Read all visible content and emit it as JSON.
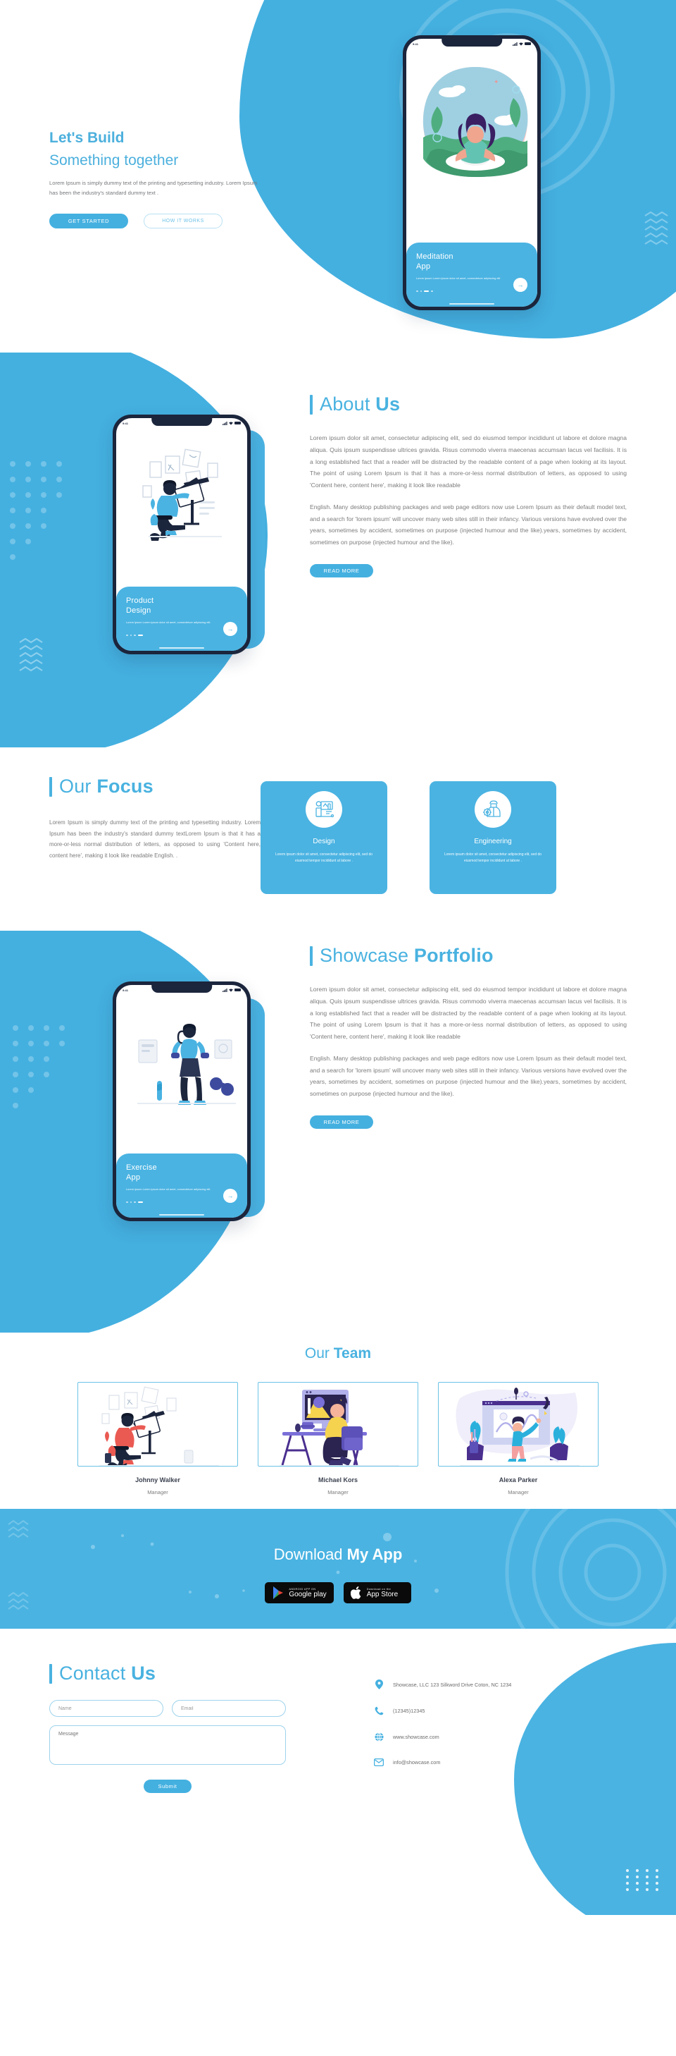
{
  "theme": {
    "accent": "#44b0e0",
    "accent_dark": "#1b253c",
    "text": "#7c7c7c"
  },
  "hero": {
    "title_line1": "Let's Build",
    "title_line2": "Something together",
    "paragraph": "Lorem Ipsum is simply dummy text of the printing and typesetting industry. Lorem Ipsum has been the industry's standard dummy text .",
    "primary_button": "GET STARTED",
    "secondary_button": "HOW IT WORKS",
    "phone": {
      "status_time": "9:41",
      "card_title_line1": "Meditation",
      "card_title_line2": "App",
      "card_text": "Lorem ipsum Lorem ipsum dolor sit amet, consectetuer adipiscing elit",
      "next_icon": "arrow-right-icon"
    }
  },
  "about": {
    "title_light": "About",
    "title_bold": "Us",
    "paragraph1": "Lorem ipsum dolor sit amet, consectetur adipiscing elit, sed do eiusmod tempor incididunt ut labore et dolore magna aliqua. Quis ipsum suspendisse ultrices gravida. Risus commodo viverra maecenas accumsan lacus vel facilisis. It is a long established fact that a reader will be distracted by the readable content of a page when looking at its layout. The point of using Lorem Ipsum is that it has a more-or-less normal distribution of letters, as opposed to using 'Content here, content here', making it look like readable",
    "paragraph2": "English. Many desktop publishing packages and web page editors now use Lorem Ipsum as their default model text, and a search for 'lorem ipsum' will uncover many web sites still in their infancy. Various versions have evolved over the years, sometimes by accident, sometimes on purpose (injected humour and the like).years, sometimes by accident, sometimes on purpose (injected humour and the like).",
    "read_more": "READ MORE",
    "phone": {
      "status_time": "9:41",
      "card_title_line1": "Product",
      "card_title_line2": "Design",
      "card_text": "Lorem ipsum Lorem ipsum dolor sit amet, consectetuer adipiscing elit.",
      "next_icon": "arrow-right-icon"
    }
  },
  "focus": {
    "title_light": "Our",
    "title_bold": "Focus",
    "paragraph": "Lorem Ipsum is simply dummy text of the printing and typesetting industry. Lorem Ipsum has been the industry's standard dummy textLorem Ipsum is that it has a more-or-less normal distribution of letters, as opposed to using 'Content here, content here', making it look like readable English. .",
    "cards": [
      {
        "icon": "design-desk-icon",
        "title": "Design",
        "text": "Lorem ipsum dolor sit amet, consectetur adipiscing elit, sed do eiusmod tempor incididunt ut labore ."
      },
      {
        "icon": "engineer-gear-icon",
        "title": "Engineering",
        "text": "Lorem ipsum dolor sit amet, consectetur adipiscing elit, sed do eiusmod tempor incididunt ut labore ."
      }
    ]
  },
  "showcase": {
    "title_light": "Showcase",
    "title_bold": "Portfolio",
    "paragraph1": "Lorem ipsum dolor sit amet, consectetur adipiscing elit, sed do eiusmod tempor incididunt ut labore et dolore magna aliqua. Quis ipsum suspendisse ultrices gravida. Risus commodo viverra maecenas accumsan lacus vel facilisis. It is a long established fact that a reader will be distracted by the readable content of a page when looking at its layout. The point of using Lorem Ipsum is that it has a more-or-less normal distribution of letters, as opposed to using 'Content here, content here', making it look like readable",
    "paragraph2": "English. Many desktop publishing packages and web page editors now use Lorem Ipsum as their default model text, and a search for 'lorem ipsum' will uncover many web sites still in their infancy. Various versions have evolved over the years, sometimes by accident, sometimes on purpose (injected humour and the like).years, sometimes by accident, sometimes on purpose (injected humour and the like).",
    "read_more": "READ MORE",
    "phone": {
      "status_time": "9:41",
      "card_title_line1": "Exercise",
      "card_title_line2": "App",
      "card_text": "Lorem ipsum Lorem ipsum dolor sit amet, consectetuer adipiscing elit.",
      "next_icon": "arrow-right-icon"
    }
  },
  "team": {
    "title_light": "Our",
    "title_bold": "Team",
    "members": [
      {
        "name": "Johnny Walker",
        "role": "Manager",
        "illustration": "illustrator-at-easel-icon"
      },
      {
        "name": "Michael Kors",
        "role": "Manager",
        "illustration": "designer-at-desktop-icon"
      },
      {
        "name": "Alexa Parker",
        "role": "Manager",
        "illustration": "woman-presenting-chart-icon"
      }
    ]
  },
  "download": {
    "title_light": "Download",
    "title_bold": "My App",
    "badges": [
      {
        "icon": "google-play-icon",
        "line1": "ANDROID APP ON",
        "line2": "Google play"
      },
      {
        "icon": "apple-icon",
        "line1": "Download on the",
        "line2": "App Store"
      }
    ]
  },
  "contact": {
    "title_light": "Contact",
    "title_bold": "Us",
    "form": {
      "name_placeholder": "Name",
      "email_placeholder": "Email",
      "message_placeholder": "Message",
      "submit_label": "Submit"
    },
    "info": [
      {
        "icon": "map-pin-icon",
        "text": "Showcase, LLC 123 Silkword Drive Coton, NC 1234"
      },
      {
        "icon": "phone-icon",
        "text": "(12345)12345"
      },
      {
        "icon": "globe-icon",
        "text": "www.showcase.com"
      },
      {
        "icon": "envelope-icon",
        "text": "info@showcase.com"
      }
    ]
  }
}
